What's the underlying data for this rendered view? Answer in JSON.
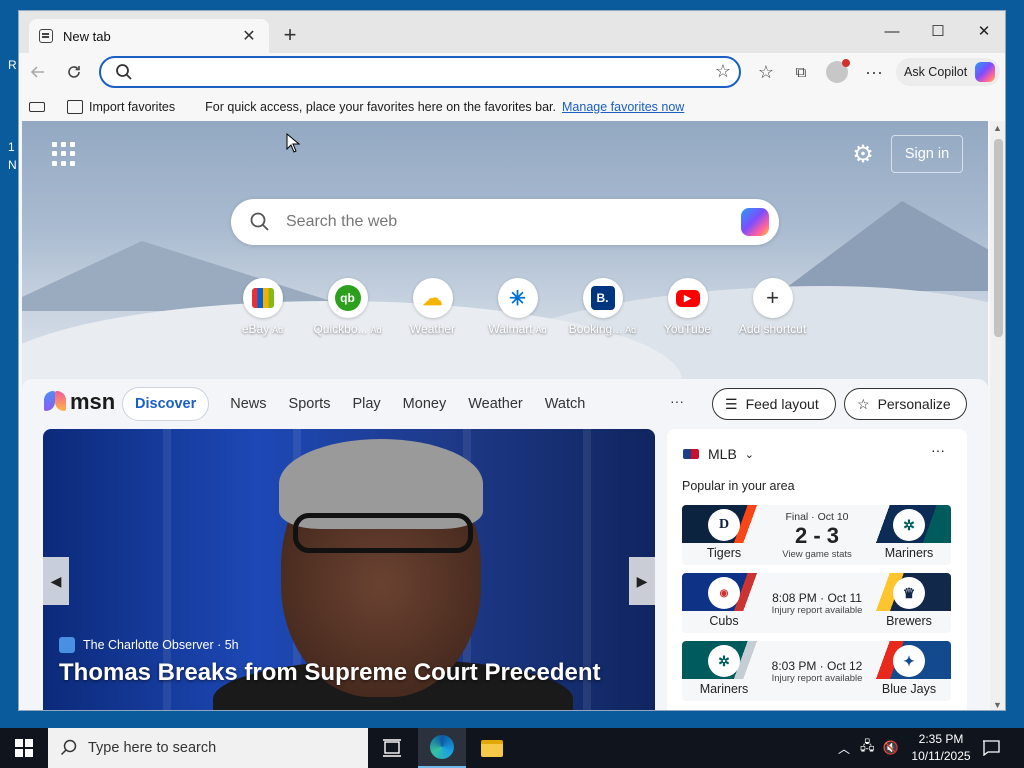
{
  "desktop": {
    "left_letters": [
      "R",
      "1",
      "N"
    ]
  },
  "browser": {
    "tab": {
      "title": "New tab"
    },
    "window_controls": {
      "minimize": "—",
      "maximize": "☐",
      "close": "✕"
    },
    "address_bar": {
      "value": "",
      "placeholder": ""
    },
    "ask_copilot_label": "Ask Copilot",
    "favorites_bar": {
      "import_label": "Import favorites",
      "message": "For quick access, place your favorites here on the favorites bar.",
      "manage_link": "Manage favorites now"
    }
  },
  "newtab": {
    "signin_label": "Sign in",
    "search_placeholder": "Search the web",
    "shortcuts": [
      {
        "label": "eBay",
        "ad": "Ad",
        "icon": "ebay-icon"
      },
      {
        "label": "Quickbo...",
        "ad": "Ad",
        "icon": "quickbooks-icon"
      },
      {
        "label": "Weather",
        "ad": "",
        "icon": "weather-icon"
      },
      {
        "label": "Walmart",
        "ad": "Ad",
        "icon": "walmart-icon"
      },
      {
        "label": "Booking...",
        "ad": "Ad",
        "icon": "booking-icon"
      },
      {
        "label": "YouTube",
        "ad": "",
        "icon": "youtube-icon"
      },
      {
        "label": "Add shortcut",
        "ad": "",
        "icon": "plus-icon"
      }
    ]
  },
  "msn": {
    "logo_text": "msn",
    "nav": [
      "Discover",
      "News",
      "Sports",
      "Play",
      "Money",
      "Weather",
      "Watch"
    ],
    "nav_more": "···",
    "feed_layout_label": "Feed layout",
    "personalize_label": "Personalize",
    "hero": {
      "source": "The Charlotte Observer",
      "age": "5h",
      "headline": "Thomas Breaks from Supreme Court Precedent"
    },
    "mlb": {
      "title": "MLB",
      "more": "···",
      "subtitle": "Popular in your area",
      "games": [
        {
          "away": "Tigers",
          "home": "Mariners",
          "line1": "Final · Oct 10",
          "score": "2 - 3",
          "line3": "View game stats"
        },
        {
          "away": "Cubs",
          "home": "Brewers",
          "line1": "",
          "score": "",
          "time": "8:08 PM · Oct 11",
          "line3": "Injury report available"
        },
        {
          "away": "Mariners",
          "home": "Blue Jays",
          "line1": "",
          "score": "",
          "time": "8:03 PM · Oct 12",
          "line3": "Injury report available"
        }
      ]
    }
  },
  "taskbar": {
    "search_placeholder": "Type here to search",
    "time": "2:35 PM",
    "date": "10/11/2025"
  },
  "colors": {
    "accent": "#1a5fc4",
    "desktop": "#0a5b9c",
    "taskbar": "#10151d"
  }
}
